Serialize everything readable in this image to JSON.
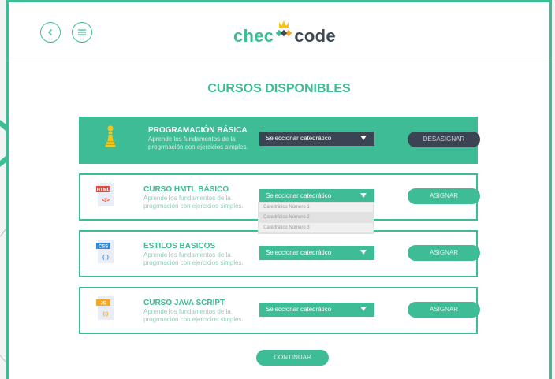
{
  "header": {
    "logo_left": "chec",
    "logo_right": "code",
    "back_icon": "chevron-left-icon",
    "menu_icon": "menu-icon"
  },
  "page_title": "CURSOS DISPONIBLES",
  "courses": [
    {
      "name": "PROGRAMACIÓN BÁSICA",
      "description": "Aprende los fundamentos de la progrmación con ejercicios simples.",
      "dropdown": "Seleccionar catedrático",
      "action": "DESASIGNAR",
      "icon": "chess-pawn-icon"
    },
    {
      "name": "CURSO HMTL BÁSICO",
      "description": "Aprende los fundamentos de la progrmación con ejercicios simples.",
      "dropdown": "Seleccionar catedrático",
      "action": "ASIGNAR",
      "icon_tag": "HTML",
      "icon_glyph": "</>"
    },
    {
      "name": "ESTILOS BASICOS",
      "description": "Aprende los fundamentos de la progrmación con ejercicios simples.",
      "dropdown": "Seleccionar catedrático",
      "action": "ASIGNAR",
      "icon_tag": "CSS",
      "icon_glyph": "{..}"
    },
    {
      "name": "CURSO JAVA SCRIPT",
      "description": "Aprende los fundamentos de la progrmación con ejercicios simples.",
      "dropdown": "Seleccionar catedrático",
      "action": "ASIGNAR",
      "icon_tag": "JS",
      "icon_glyph": "{;}"
    }
  ],
  "dropdown_options": [
    "Catedrático Número 1",
    "Catedrático Número 2",
    "Catedrático Número 3"
  ],
  "continue_label": "CONTINUAR",
  "colors": {
    "accent": "#3dbc96",
    "dark": "#3a4452"
  }
}
